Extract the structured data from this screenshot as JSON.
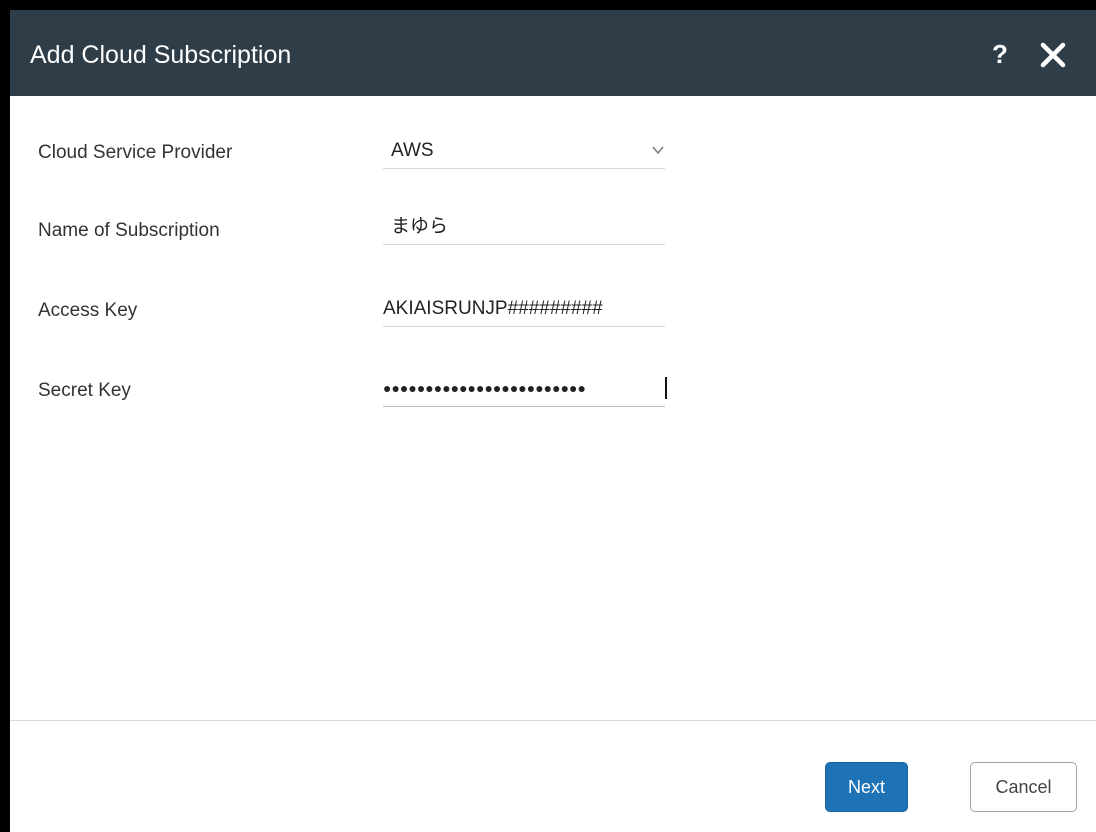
{
  "dialog": {
    "title": "Add Cloud Subscription",
    "help_icon": "help-icon",
    "close_icon": "close-icon",
    "colors": {
      "titlebar": "#2f3d48",
      "primary_button": "#1e73b7"
    }
  },
  "form": {
    "provider": {
      "label": "Cloud Service Provider",
      "value": "AWS",
      "icon": "chevron-down-icon"
    },
    "name": {
      "label": "Name of Subscription",
      "value": "まゆら"
    },
    "access_key": {
      "label": "Access Key",
      "value": "AKIAISRUNJP#########"
    },
    "secret_key": {
      "label": "Secret Key",
      "value": "●●●●●●●●●●●●●●●●●●●●●●●●"
    }
  },
  "footer": {
    "next_label": "Next",
    "cancel_label": "Cancel"
  }
}
